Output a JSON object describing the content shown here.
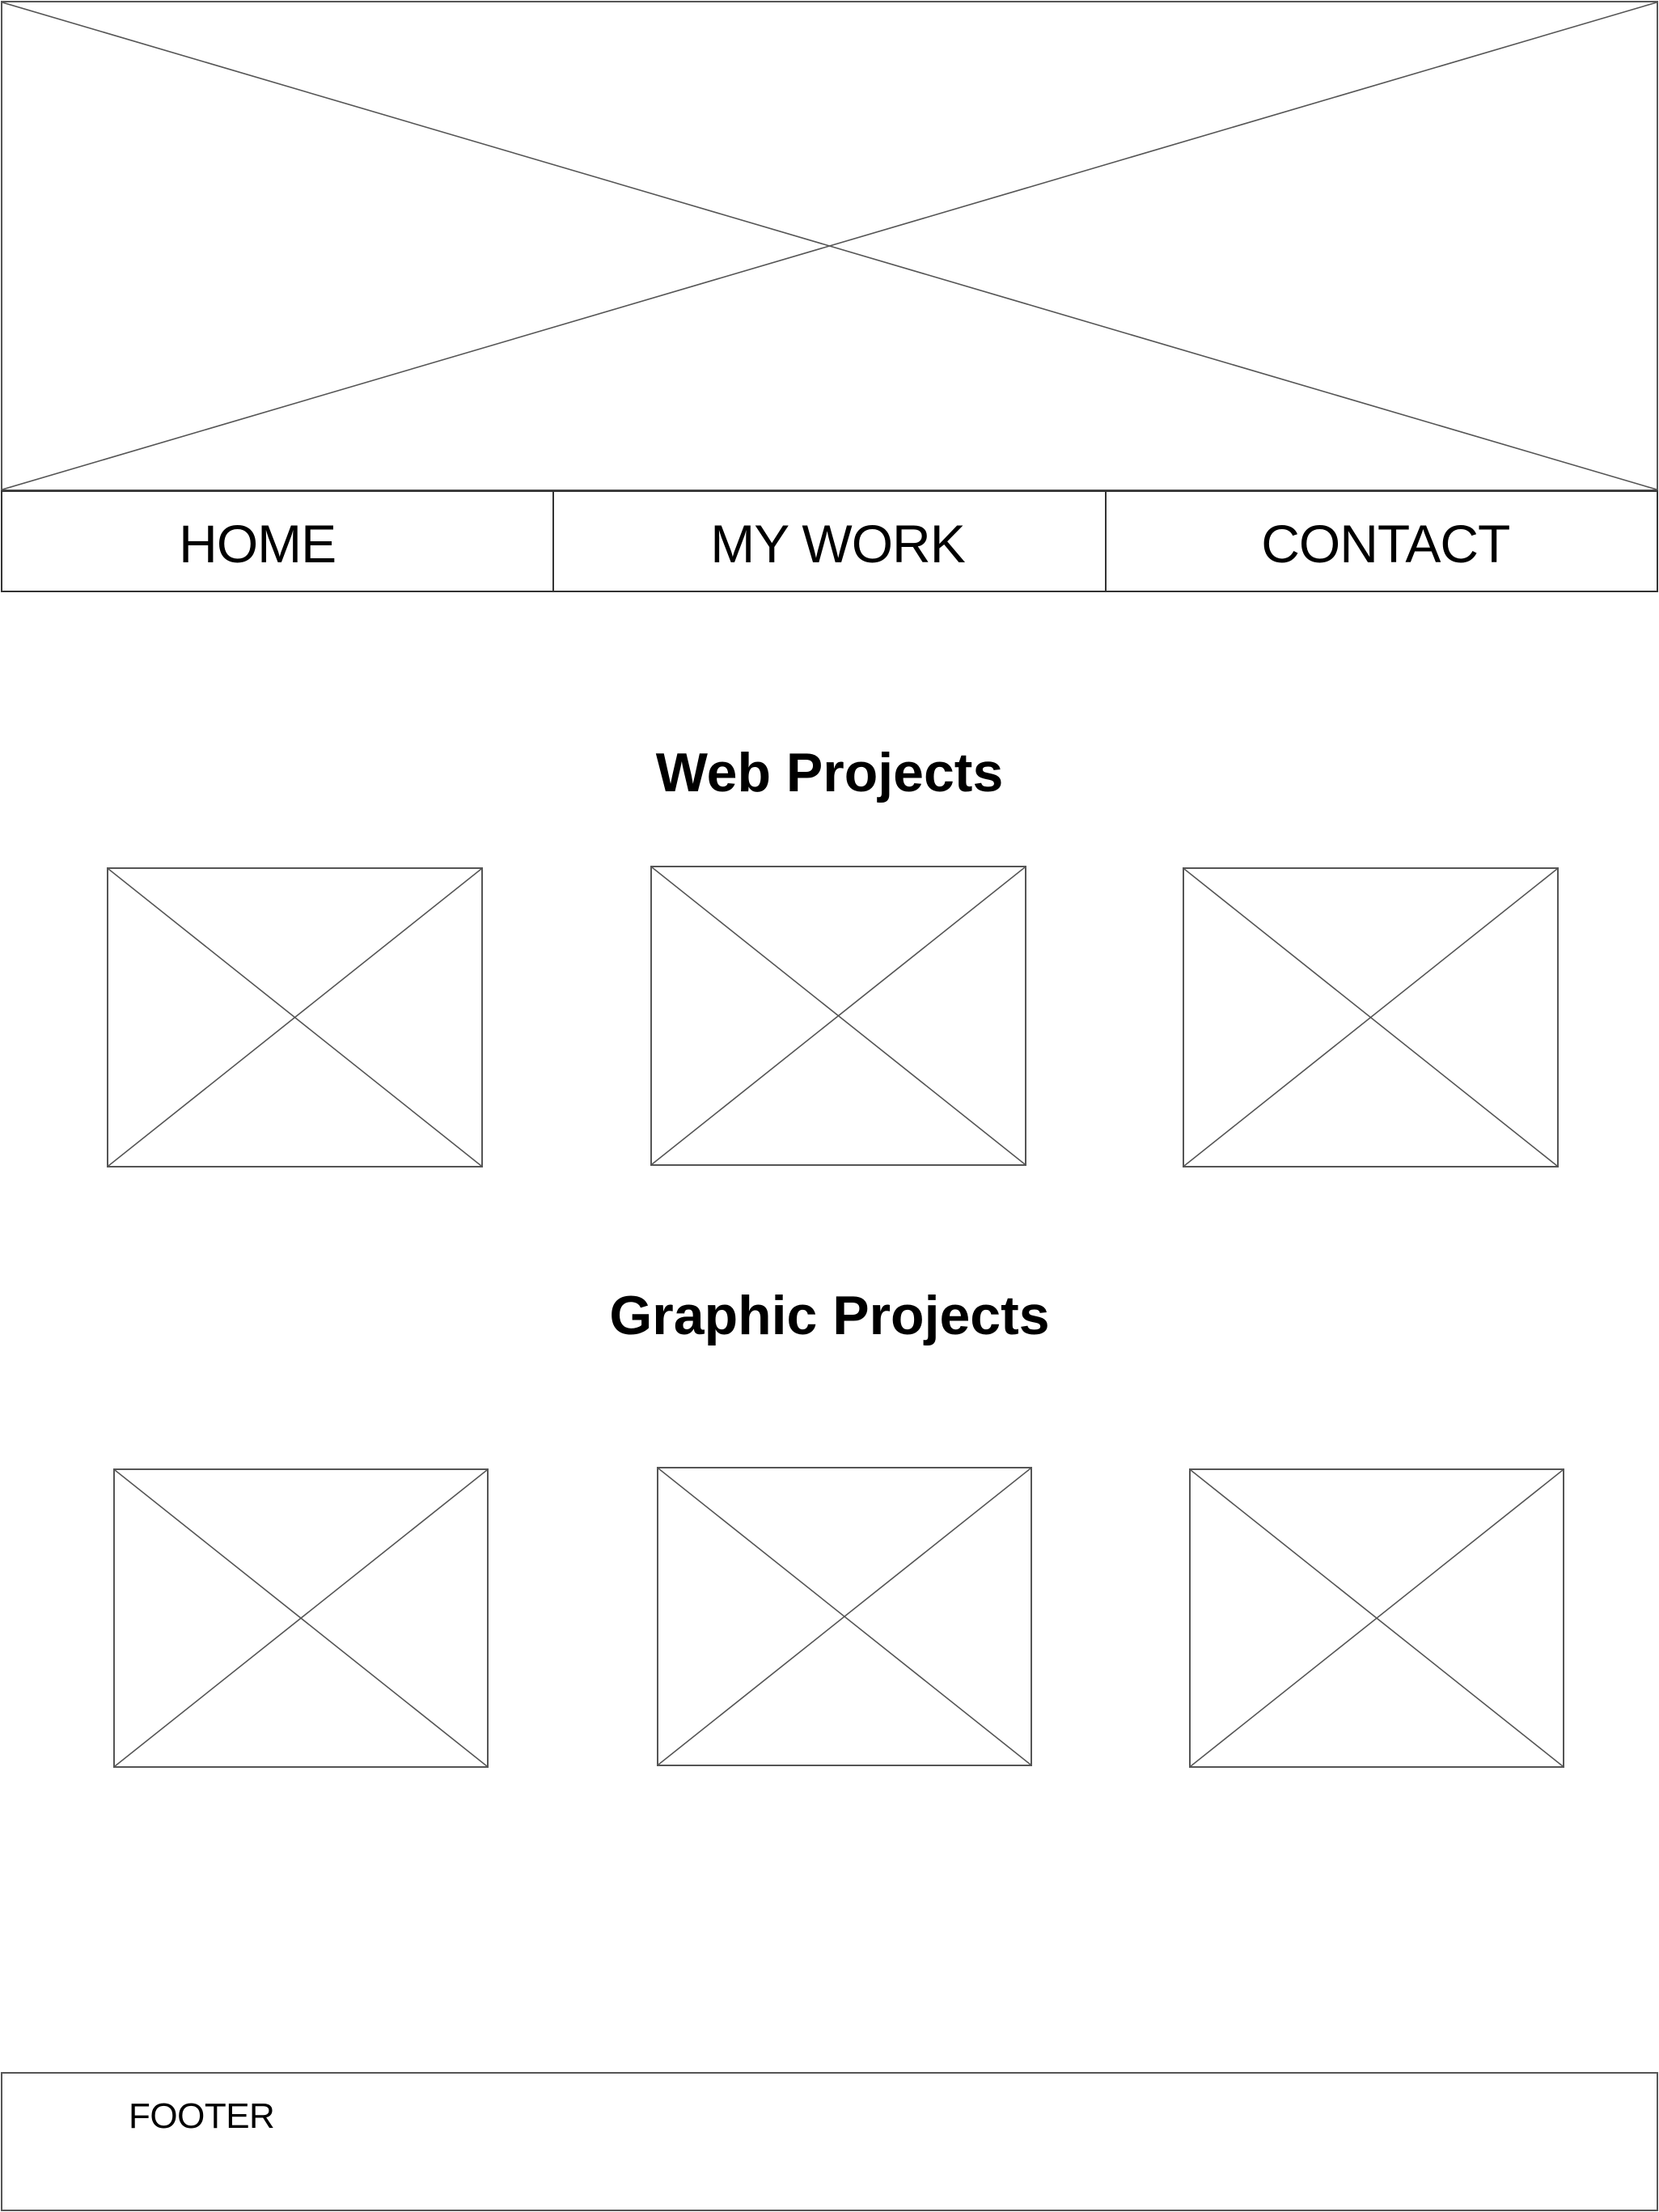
{
  "nav": {
    "items": [
      {
        "label": "HOME"
      },
      {
        "label": "MY WORK"
      },
      {
        "label": "CONTACT"
      }
    ]
  },
  "sections": {
    "web": {
      "heading": "Web Projects"
    },
    "graphic": {
      "heading": "Graphic Projects"
    }
  },
  "footer": {
    "label": "FOOTER"
  },
  "colors": {
    "background": "#ffffff",
    "wireframe_line": "#555555",
    "text": "#000000"
  }
}
